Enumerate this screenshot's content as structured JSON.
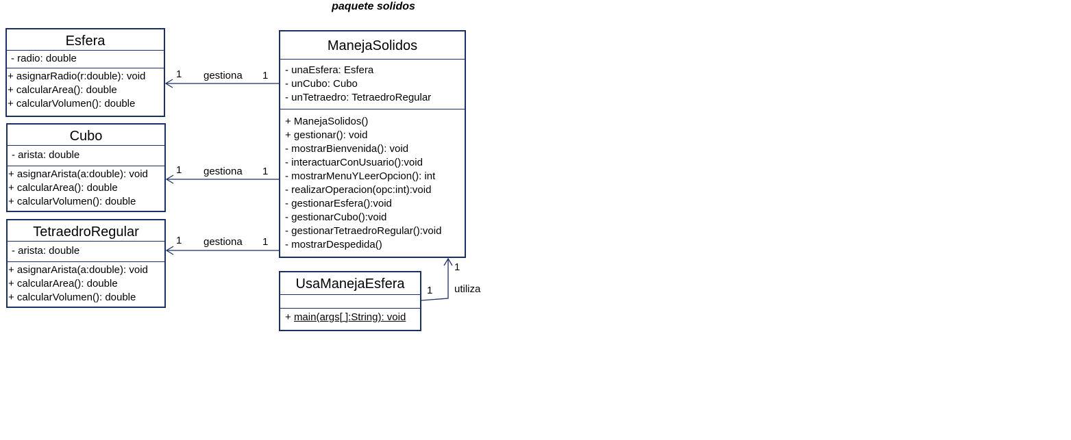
{
  "title": "paquete solidos",
  "classes": {
    "esfera": {
      "name": "Esfera",
      "attributes": [
        "- radio: double"
      ],
      "operations": [
        "+ asignarRadio(r:double): void",
        "+ calcularArea(): double",
        "+ calcularVolumen(): double"
      ]
    },
    "cubo": {
      "name": "Cubo",
      "attributes": [
        "- arista: double"
      ],
      "operations": [
        "+ asignarArista(a:double): void",
        "+ calcularArea(): double",
        "+ calcularVolumen(): double"
      ]
    },
    "tetraedro": {
      "name": "TetraedroRegular",
      "attributes": [
        "- arista: double"
      ],
      "operations": [
        "+ asignarArista(a:double): void",
        "+ calcularArea(): double",
        "+ calcularVolumen(): double"
      ]
    },
    "manejaSolidos": {
      "name": "ManejaSolidos",
      "attributes": [
        "- unaEsfera: Esfera",
        "- unCubo: Cubo",
        "- unTetraedro: TetraedroRegular"
      ],
      "operations": [
        "+ ManejaSolidos()",
        "+ gestionar(): void",
        "- mostrarBienvenida(): void",
        "- interactuarConUsuario():void",
        "- mostrarMenuYLeerOpcion(): int",
        "- realizarOperacion(opc:int):void",
        "- gestionarEsfera():void",
        "- gestionarCubo():void",
        "- gestionarTetraedroRegular():void",
        "- mostrarDespedida()"
      ]
    },
    "usaManeja": {
      "name": "UsaManejaEsfera",
      "attributes": [],
      "op_prefix": "+ ",
      "op_static": "main(args[ ]:String): void"
    }
  },
  "associations": [
    {
      "label": "gestiona",
      "source_mult": "1",
      "target_mult": "1"
    },
    {
      "label": "gestiona",
      "source_mult": "1",
      "target_mult": "1"
    },
    {
      "label": "gestiona",
      "source_mult": "1",
      "target_mult": "1"
    },
    {
      "label": "utiliza",
      "source_mult": "1",
      "target_mult": "1"
    }
  ],
  "colors": {
    "border": "#1a2f66",
    "line": "#1a2f66"
  }
}
